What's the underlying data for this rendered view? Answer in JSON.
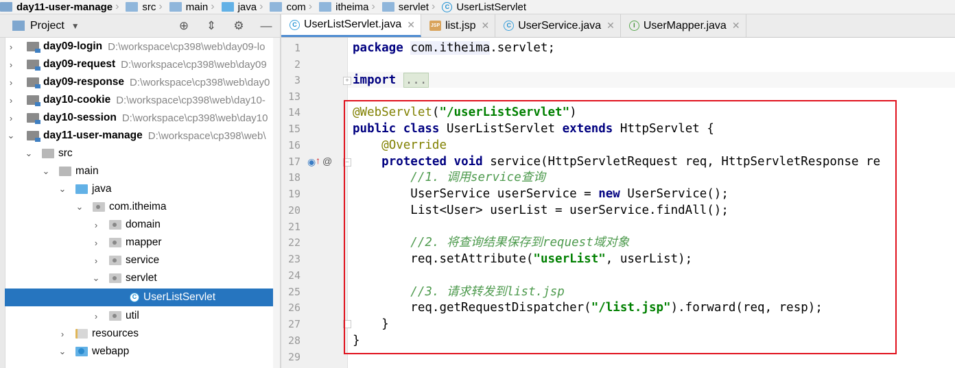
{
  "breadcrumbs": [
    "day11-user-manage",
    "src",
    "main",
    "java",
    "com",
    "itheima",
    "servlet",
    "UserListServlet"
  ],
  "project_panel": {
    "title": "Project",
    "tools": [
      "crosshair-icon",
      "collapse-icon",
      "gear-icon",
      "minimize-icon"
    ]
  },
  "tree": [
    {
      "name": "day09-login",
      "path": "D:\\workspace\\cp398\\web\\day09-lo",
      "arrow": "›",
      "icon": "mod",
      "bold": true
    },
    {
      "name": "day09-request",
      "path": "D:\\workspace\\cp398\\web\\day09",
      "arrow": "›",
      "icon": "mod",
      "bold": true
    },
    {
      "name": "day09-response",
      "path": "D:\\workspace\\cp398\\web\\day0",
      "arrow": "›",
      "icon": "mod",
      "bold": true
    },
    {
      "name": "day10-cookie",
      "path": "D:\\workspace\\cp398\\web\\day10-",
      "arrow": "›",
      "icon": "mod",
      "bold": true
    },
    {
      "name": "day10-session",
      "path": "D:\\workspace\\cp398\\web\\day10",
      "arrow": "›",
      "icon": "mod",
      "bold": true
    },
    {
      "name": "day11-user-manage",
      "path": "D:\\workspace\\cp398\\web\\",
      "arrow": "⌄",
      "icon": "mod",
      "bold": true
    },
    {
      "name": "src",
      "path": "",
      "arrow": "⌄",
      "icon": "src",
      "bold": false
    },
    {
      "name": "main",
      "path": "",
      "arrow": "⌄",
      "icon": "src",
      "bold": false
    },
    {
      "name": "java",
      "path": "",
      "arrow": "⌄",
      "icon": "java",
      "bold": false
    },
    {
      "name": "com.itheima",
      "path": "",
      "arrow": "⌄",
      "icon": "pkg",
      "bold": false
    },
    {
      "name": "domain",
      "path": "",
      "arrow": "›",
      "icon": "pkg",
      "bold": false
    },
    {
      "name": "mapper",
      "path": "",
      "arrow": "›",
      "icon": "pkg",
      "bold": false
    },
    {
      "name": "service",
      "path": "",
      "arrow": "›",
      "icon": "pkg",
      "bold": false
    },
    {
      "name": "servlet",
      "path": "",
      "arrow": "⌄",
      "icon": "pkg",
      "bold": false
    },
    {
      "name": "UserListServlet",
      "path": "",
      "arrow": "",
      "icon": "cls",
      "bold": false
    },
    {
      "name": "util",
      "path": "",
      "arrow": "›",
      "icon": "pkg",
      "bold": false
    },
    {
      "name": "resources",
      "path": "",
      "arrow": "›",
      "icon": "res",
      "bold": false
    },
    {
      "name": "webapp",
      "path": "",
      "arrow": "⌄",
      "icon": "web",
      "bold": false
    }
  ],
  "tabs": [
    {
      "label": "UserListServlet.java",
      "icon": "C",
      "active": true
    },
    {
      "label": "list.jsp",
      "icon": "JSP",
      "active": false
    },
    {
      "label": "UserService.java",
      "icon": "C",
      "active": false
    },
    {
      "label": "UserMapper.java",
      "icon": "I",
      "active": false
    }
  ],
  "code": {
    "line_numbers": [
      "1",
      "2",
      "3",
      "13",
      "14",
      "15",
      "16",
      "17",
      "18",
      "19",
      "20",
      "21",
      "22",
      "23",
      "24",
      "25",
      "26",
      "27",
      "28",
      "29"
    ],
    "l1_kw": "package",
    "l1_pkg": "com.itheima",
    "l1_rest": ".servlet;",
    "l3_kw": "import",
    "l3_fold": "...",
    "l14_ann": "@WebServlet",
    "l14_open": "(",
    "l14_str": "\"/userListServlet\"",
    "l14_close": ")",
    "l15_kw1": "public",
    "l15_kw2": "class",
    "l15_name": "UserListServlet",
    "l15_kw3": "extends",
    "l15_rest": "HttpServlet {",
    "l16_ann": "@Override",
    "l17_kw1": "protected",
    "l17_kw2": "void",
    "l17_rest": "service(HttpServletRequest req, HttpServletResponse re",
    "l18_cmt": "//1. 调用service查询",
    "l19_a": "UserService userService = ",
    "l19_kw": "new",
    "l19_b": " UserService();",
    "l20": "List<User> userList = userService.findAll();",
    "l22_cmt": "//2. 将查询结果保存到request域对象",
    "l23_a": "req.setAttribute(",
    "l23_str": "\"userList\"",
    "l23_b": ", userList);",
    "l25_cmt": "//3. 请求转发到list.jsp",
    "l26_a": "req.getRequestDispatcher(",
    "l26_str": "\"/list.jsp\"",
    "l26_b": ").forward(req, resp);",
    "l27": "}",
    "l28": "}"
  },
  "colors": {
    "highlight_box": "#e0101c",
    "selection": "#2675bf",
    "keyword": "#000080",
    "string": "#008000"
  }
}
